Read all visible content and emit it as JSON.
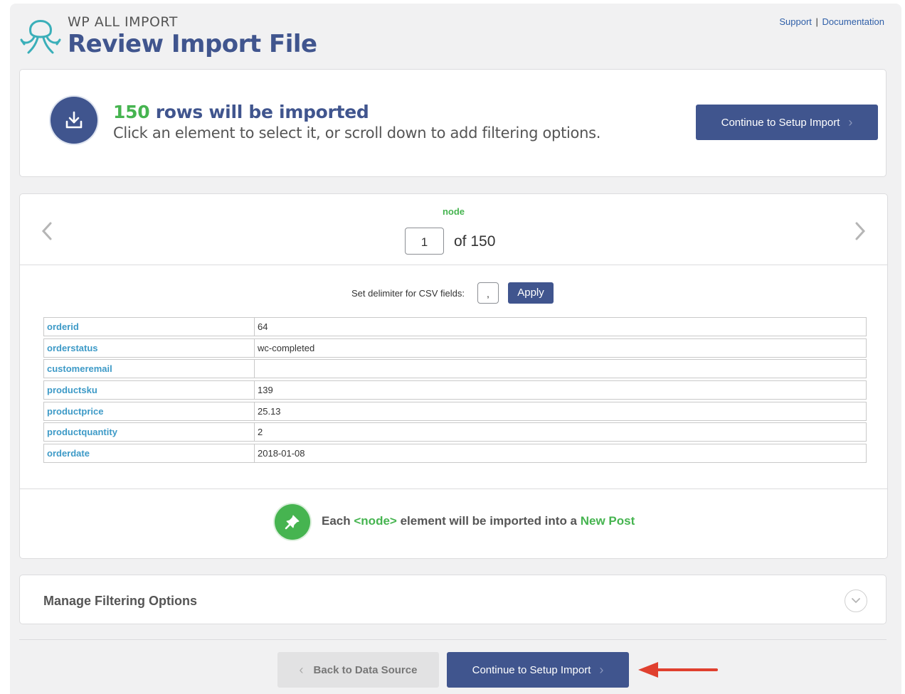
{
  "header": {
    "brand": "WP ALL IMPORT",
    "title": "Review Import File",
    "links": {
      "support": "Support",
      "separator": "|",
      "documentation": "Documentation"
    }
  },
  "summary": {
    "count": "150",
    "count_suffix": "rows will be imported",
    "instruction": "Click an element to select it, or scroll down to add filtering options.",
    "continue_label": "Continue to Setup Import"
  },
  "preview": {
    "element_label": "node",
    "current_record": "1",
    "of_text": "of 150",
    "delimiter_label": "Set delimiter for CSV fields:",
    "delimiter_value": ",",
    "apply_label": "Apply",
    "rows": [
      {
        "key": "orderid",
        "value": "64"
      },
      {
        "key": "orderstatus",
        "value": "wc-completed"
      },
      {
        "key": "customeremail",
        "value": ""
      },
      {
        "key": "productsku",
        "value": "139"
      },
      {
        "key": "productprice",
        "value": "25.13"
      },
      {
        "key": "productquantity",
        "value": "2"
      },
      {
        "key": "orderdate",
        "value": "2018-01-08"
      }
    ],
    "import_note": {
      "prefix": "Each",
      "node": "<node>",
      "middle": "element will be imported into a",
      "target": "New Post"
    }
  },
  "filtering": {
    "title": "Manage Filtering Options"
  },
  "footer": {
    "back_label": "Back to Data Source",
    "continue_label": "Continue to Setup Import"
  },
  "colors": {
    "primary": "#40558e",
    "green": "#46b450",
    "key_blue": "#3d9ac7",
    "arrow_red": "#e0402f"
  },
  "icons": {
    "logo": "octopus-logo-icon",
    "download": "download-icon",
    "pin": "pin-icon",
    "prev": "chevron-left-icon",
    "next": "chevron-right-icon",
    "toggle": "chevron-down-icon",
    "annotation": "red-arrow-icon"
  }
}
